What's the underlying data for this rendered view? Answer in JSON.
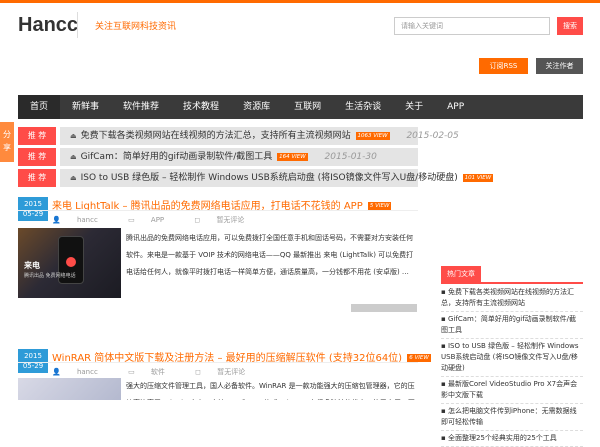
{
  "header": {
    "logo": "Hancc",
    "tagline": "关注互联网科技资讯",
    "search_placeholder": "请输入关键词",
    "search_button": "搜索",
    "rss_button": "订阅RSS",
    "follow_button": "关注作者hancc"
  },
  "nav": [
    "首页",
    "新鲜事",
    "软件推荐",
    "技术教程",
    "资源库",
    "互联网",
    "生活杂谈",
    "关于",
    "APP"
  ],
  "side_share": [
    "分",
    "享"
  ],
  "recommend": [
    {
      "tag": "推 荐",
      "title": "免费下载各类视频网站在线视频的方法汇总，支持所有主流视频网站",
      "views": "1063 VIEW",
      "date": "2015-02-05"
    },
    {
      "tag": "推 荐",
      "title": "GifCam：简单好用的gif动画录制软件/截图工具",
      "views": "164 VIEW",
      "date": "2015-01-30"
    },
    {
      "tag": "推 荐",
      "title": "ISO to USB 绿色版 – 轻松制作 Windows USB系统启动盘 (将ISO镜像文件写入U盘/移动硬盘)",
      "views": "101 VIEW",
      "date": ""
    }
  ],
  "posts": [
    {
      "date_year": "2015",
      "date_day": "05-29",
      "title": "来电 LightTalk – 腾讯出品的免费网络电话应用，打电话不花钱的 APP",
      "views": "5 VIEW",
      "author": "hancc",
      "category": "APP",
      "comments": "暂无评论",
      "thumb_text": "来电",
      "thumb_sub": "腾讯出品 免费网络电话",
      "excerpt": "腾讯出品的免费网络电话应用，可以免费拨打全国任意手机和固话号码，不需要对方安装任何软件。来电是一款基于 VOIP 技术的网络电话——QQ 最新推出 来电 (LightTalk) 可以免费打电话给任何人，就像平时拨打电话一样简单方便，通话质量高，一分钱都不用花 (安卓版) …"
    },
    {
      "date_year": "2015",
      "date_day": "05-29",
      "title": "WinRAR 简体中文版下载及注册方法 – 最好用的压缩解压软件 (支持32位64位)",
      "views": "6 VIEW",
      "author": "hancc",
      "category": "软件",
      "comments": "暂无评论",
      "excerpt": "强大的压缩文件管理工具，国人必备软件。WinRAR 是一款功能强大的压缩包管理器，它的压缩率比高于 WinZip 之上，支持RAR 和 ZIP 格式 WinRAR 有很多独特的优点，使用方便，压缩效率高"
    }
  ],
  "sidebar": {
    "widget_title": "热门文章",
    "items": [
      "免费下载各类视频网站在线视频的方法汇总，支持所有主流视频网站",
      "GifCam：简单好用的gif动画录制软件/截图工具",
      "ISO to USB 绿色版 – 轻松制作 Windows USB系统启动盘 (将ISO镜像文件写入U盘/移动硬盘)",
      "最新版Corel VideoStudio Pro X7会声会影中文版下载",
      "怎么把电脑文件传到iPhone：无需数据线即可轻松传输",
      "全面整理25个经典实用的25个工具"
    ]
  },
  "colors": {
    "accent": "#ff6a00",
    "red": "#ff4c48",
    "date_blue": "#2e9bd8",
    "nav_bg": "#3a3a3a"
  }
}
